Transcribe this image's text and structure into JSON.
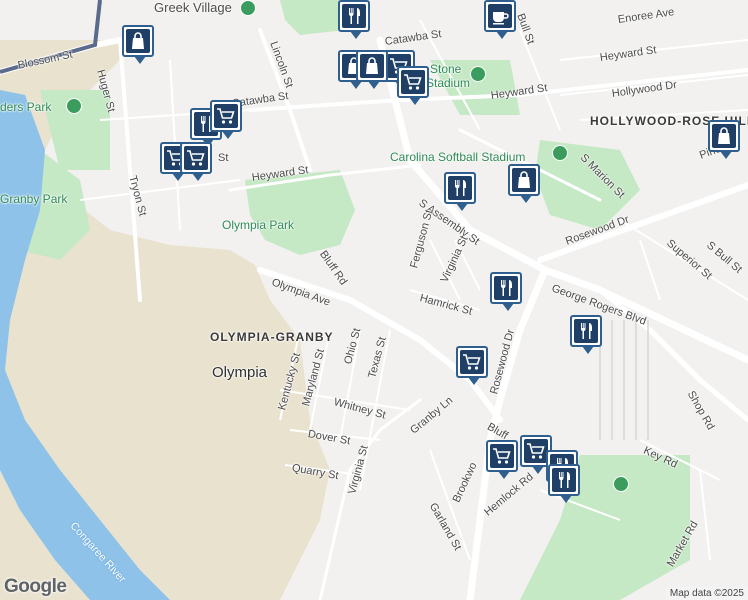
{
  "map": {
    "labels": {
      "greek_village": "Greek Village",
      "blossom_st": "Blossom St",
      "huger_st": "Huger St",
      "lincoln_st": "Lincoln St",
      "catawba_st_1": "Catawba St",
      "catawba_st_2": "Catawba St",
      "stone_stadium_1": "Stone",
      "stone_stadium_2": "Stadium",
      "bull_st": "Bull St",
      "enoree_ave": "Enoree Ave",
      "heyward_st_1": "Heyward St",
      "heyward_st_2": "Heyward St",
      "heyward_st_3": "Heyward St",
      "hollywood_dr": "Hollywood Dr",
      "hollywood_rose_hill": "HOLLYWOOD-ROSE HILL",
      "riders_park": "ders Park",
      "tryon_st": "Tryon St",
      "granby_park": "Granby Park",
      "olympia_park": "Olympia Park",
      "carolina_softball": "Carolina Softball Stadium",
      "s_marion_st": "S Marion St",
      "pinewood": "Pinewo",
      "s_assembly_st": "S Assembly St",
      "rosewood_dr_1": "Rosewood Dr",
      "rosewood_dr_2": "Rosewood Dr",
      "superior_st": "Superior St",
      "s_bull_st": "S Bull St",
      "ferguson_st": "Ferguson St",
      "virginia_st_1": "Virginia St",
      "virginia_st_2": "Virginia St",
      "bluff_rd_1": "Bluff Rd",
      "bluff_rd_2": "Bluff",
      "olympia_ave": "Olympia Ave",
      "hamrick_st": "Hamrick St",
      "george_rogers_blvd": "George Rogers Blvd",
      "olympia_granby": "OLYMPIA-GRANBY",
      "olympia": "Olympia",
      "kentucky_st": "Kentucky St",
      "maryland_st": "Maryland St",
      "ohio_st": "Ohio St",
      "texas_st": "Texas St",
      "whitney_st": "Whitney St",
      "granby_ln": "Granby Ln",
      "dover_st": "Dover St",
      "quarry_st": "Quarry St",
      "shop_rd": "Shop Rd",
      "key_rd": "Key Rd",
      "brookwood": "Brookwo",
      "hemlock_rd": "Hemlock Rd",
      "garland_st": "Garland St",
      "market_rd": "Market Rd",
      "congaree_river": "Congaree River",
      "st_fragment": "St"
    },
    "pins": [
      {
        "type": "shopping-bag",
        "label": "Shopping"
      },
      {
        "type": "restaurant",
        "label": "Restaurant"
      },
      {
        "type": "coffee",
        "label": "Cafe"
      },
      {
        "type": "shopping-bag",
        "label": "Shopping"
      },
      {
        "type": "shopping-cart",
        "label": "Grocery"
      },
      {
        "type": "shopping-cart",
        "label": "Grocery"
      },
      {
        "type": "restaurant",
        "label": "Restaurant"
      },
      {
        "type": "shopping-cart",
        "label": "Grocery"
      },
      {
        "type": "shopping-cart",
        "label": "Grocery"
      },
      {
        "type": "shopping-cart",
        "label": "Grocery"
      },
      {
        "type": "shopping-bag",
        "label": "Shopping"
      },
      {
        "type": "shopping-bag",
        "label": "Shopping"
      },
      {
        "type": "shopping-bag",
        "label": "Shopping"
      },
      {
        "type": "restaurant",
        "label": "Restaurant"
      },
      {
        "type": "restaurant",
        "label": "Restaurant"
      },
      {
        "type": "shopping-cart",
        "label": "Grocery"
      },
      {
        "type": "restaurant",
        "label": "Restaurant"
      },
      {
        "type": "shopping-cart",
        "label": "Grocery"
      },
      {
        "type": "shopping-cart",
        "label": "Grocery"
      },
      {
        "type": "restaurant",
        "label": "Restaurant"
      },
      {
        "type": "restaurant",
        "label": "Restaurant"
      }
    ],
    "attribution": "Map data ©2025",
    "logo": "Google"
  },
  "colors": {
    "land": "#f2f1ef",
    "water": "#8ec2e8",
    "park": "#c5e8c5",
    "quarry": "#e9e2cf",
    "road": "#ffffff",
    "pin_border": "#2e5f8e",
    "pin_fill": "#1f3f66"
  }
}
